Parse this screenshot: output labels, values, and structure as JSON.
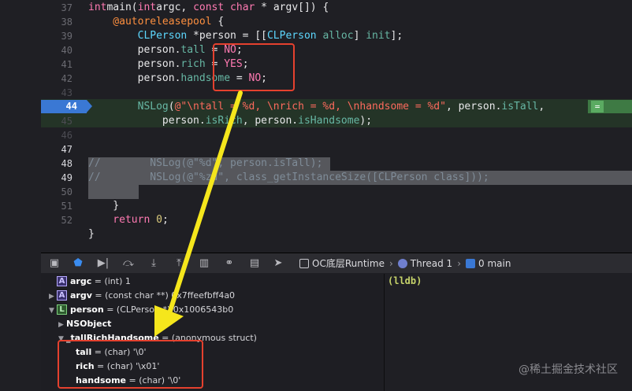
{
  "editor": {
    "line_numbers": [
      "37",
      "38",
      "39",
      "40",
      "41",
      "42",
      "43",
      "44",
      "45",
      "46",
      "47",
      "48",
      "49",
      "50",
      "51",
      "52"
    ],
    "current_line": "44",
    "lines": {
      "l37": [
        [
          "kw",
          "int"
        ],
        [
          "",
          "main("
        ],
        [
          "kw",
          "int"
        ],
        [
          "",
          "argc, "
        ],
        [
          "kw",
          "const"
        ],
        [
          "",
          ""
        ],
        [
          "kw",
          " char"
        ],
        [
          "",
          " * argv[]) {"
        ]
      ],
      "l38": [
        [
          "pp",
          "    @autoreleasepool"
        ],
        [
          "",
          " {"
        ]
      ],
      "l39": [
        [
          "ty",
          "        CLPerson"
        ],
        [
          "",
          " *person = [["
        ],
        [
          "ty",
          "CLPerson"
        ],
        [
          "",
          " "
        ],
        [
          "fn",
          "alloc"
        ],
        [
          "",
          "] "
        ],
        [
          "fn",
          "init"
        ],
        [
          "",
          "];"
        ]
      ],
      "l40": [
        [
          "",
          "        person."
        ],
        [
          "prop",
          "tall"
        ],
        [
          "",
          " = "
        ],
        [
          "kw",
          "NO"
        ],
        [
          "",
          ";"
        ]
      ],
      "l41": [
        [
          "",
          "        person."
        ],
        [
          "prop",
          "rich"
        ],
        [
          "",
          " = "
        ],
        [
          "kw",
          "YES"
        ],
        [
          "",
          ";"
        ]
      ],
      "l42": [
        [
          "",
          "        person."
        ],
        [
          "prop",
          "handsome"
        ],
        [
          "",
          " = "
        ],
        [
          "kw",
          "NO"
        ],
        [
          "",
          ";"
        ]
      ],
      "l44a": [
        [
          "fn",
          "        NSLog"
        ],
        [
          "",
          "("
        ],
        [
          "str",
          "@\"\\ntall = %d, \\nrich = %d, \\nhandsome = %d\""
        ],
        [
          "",
          ", person."
        ],
        [
          "fn",
          "isTall"
        ],
        [
          "",
          ","
        ]
      ],
      "l44b": [
        [
          "",
          "            person."
        ],
        [
          "fn",
          "isRich"
        ],
        [
          "",
          ", person."
        ],
        [
          "fn",
          "isHandsome"
        ],
        [
          "",
          ");"
        ]
      ],
      "l47": [
        [
          "cm",
          "//        NSLog(@\"%d\", person.isTall);"
        ]
      ],
      "l48": [
        [
          "cm",
          "//        NSLog(@\"%zd\", class_getInstanceSize([CLPerson class]));"
        ]
      ],
      "l50": [
        [
          "",
          "    }"
        ]
      ],
      "l51": [
        [
          "kw",
          "    return"
        ],
        [
          "",
          " "
        ],
        [
          "num",
          "0"
        ],
        [
          "",
          ";"
        ]
      ],
      "l52": [
        [
          "",
          "}"
        ]
      ]
    },
    "eq_badge": "="
  },
  "debug_bar": {
    "process": "OC底层Runtime",
    "thread": "Thread 1",
    "frame": "0 main"
  },
  "variables": [
    {
      "indent": 0,
      "toggle": "",
      "badge": "A",
      "name": "argc",
      "value": " = (int) 1"
    },
    {
      "indent": 0,
      "toggle": "▶",
      "badge": "A",
      "name": "argv",
      "value": " = (const char **) 0x7ffeefbff4a0"
    },
    {
      "indent": 0,
      "toggle": "▼",
      "badge": "L",
      "name": "person",
      "value": " = (CLPerson *) 0x1006543b0"
    },
    {
      "indent": 1,
      "toggle": "▶",
      "badge": "",
      "name": "NSObject",
      "value": ""
    },
    {
      "indent": 1,
      "toggle": "▼",
      "badge": "",
      "name": "_tallRichHandsome",
      "value": " = (anonymous struct)"
    },
    {
      "indent": 2,
      "toggle": "",
      "badge": "",
      "name": "tall",
      "value": " = (char) '\\0'"
    },
    {
      "indent": 2,
      "toggle": "",
      "badge": "",
      "name": "rich",
      "value": " = (char) '\\x01'"
    },
    {
      "indent": 2,
      "toggle": "",
      "badge": "",
      "name": "handsome",
      "value": " = (char) '\\0'"
    }
  ],
  "console": {
    "prompt": "(lldb)",
    "watermark": "@稀土掘金技术社区"
  },
  "annotation_color": "#e5412e",
  "arrow_color": "#f5e61c"
}
